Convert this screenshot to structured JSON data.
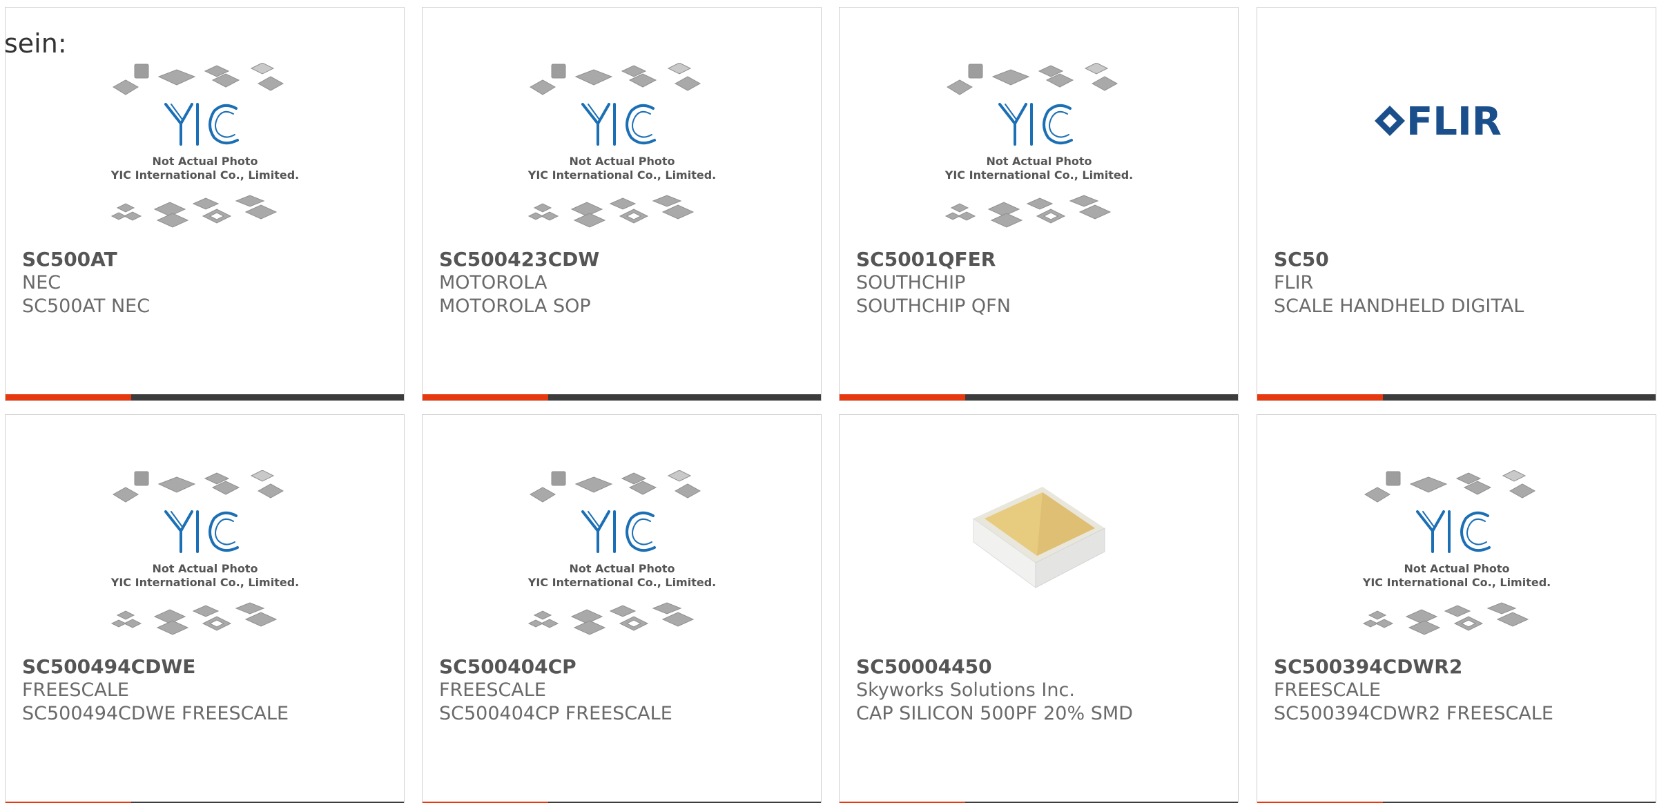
{
  "lead_text": "sein:",
  "placeholder_image": {
    "caption_line1": "Not Actual Photo",
    "caption_line2": "YIC International Co., Limited.",
    "logo_text": "YIC"
  },
  "flir_logo_text": "FLIR",
  "colors": {
    "accent": "#e6390f",
    "bar": "#3c3c3c",
    "yic_blue": "#1b6fb5",
    "flir_blue": "#1b4f8c"
  },
  "products": [
    {
      "part": "SC500AT",
      "maker": "NEC",
      "desc": "SC500AT NEC",
      "image": "yic-placeholder"
    },
    {
      "part": "SC500423CDW",
      "maker": "MOTOROLA",
      "desc": "MOTOROLA SOP",
      "image": "yic-placeholder"
    },
    {
      "part": "SC5001QFER",
      "maker": "SOUTHCHIP",
      "desc": "SOUTHCHIP QFN",
      "image": "yic-placeholder"
    },
    {
      "part": "SC50",
      "maker": "FLIR",
      "desc": "SCALE HANDHELD DIGITAL",
      "image": "flir-logo"
    },
    {
      "part": "SC500494CDWE",
      "maker": "FREESCALE",
      "desc": "SC500494CDWE FREESCALE",
      "image": "yic-placeholder"
    },
    {
      "part": "SC500404CP",
      "maker": "FREESCALE",
      "desc": "SC500404CP FREESCALE",
      "image": "yic-placeholder"
    },
    {
      "part": "SC50004450",
      "maker": "Skyworks Solutions Inc.",
      "desc": "CAP SILICON 500PF 20% SMD",
      "image": "capacitor-photo"
    },
    {
      "part": "SC500394CDWR2",
      "maker": "FREESCALE",
      "desc": "SC500394CDWR2 FREESCALE",
      "image": "yic-placeholder"
    }
  ]
}
